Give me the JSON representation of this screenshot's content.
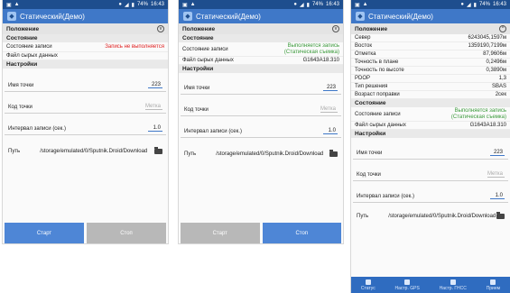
{
  "s1": {
    "status": {
      "time": "16:43",
      "battery": "74%"
    },
    "appbar": {
      "title": "Статический(Демо)"
    },
    "position_label": "Положение",
    "state_header": "Состояние",
    "record_state_label": "Состояние записи",
    "record_state_value": "Запись не выполняется",
    "raw_file_label": "Файл сырых данных",
    "settings_header": "Настройки",
    "point_name_label": "Имя точки",
    "point_name_value": "223",
    "point_code_label": "Код точки",
    "point_code_placeholder": "Метка",
    "interval_label": "Интервал записи (сек.)",
    "interval_value": "1.0",
    "path_label": "Путь",
    "path_value": "/storage/emulated/0/Sputnik.Droid/Download",
    "start_label": "Старт",
    "stop_label": "Стоп"
  },
  "s2": {
    "status": {
      "time": "16:43",
      "battery": "74%"
    },
    "appbar": {
      "title": "Статический(Демо)"
    },
    "position_label": "Положение",
    "state_header": "Состояние",
    "record_state_label": "Состояние записи",
    "record_state_value": "Выполняется запись (Статическая съемка)",
    "raw_file_label": "Файл сырых данных",
    "raw_file_value": "G1643A18.310",
    "settings_header": "Настройки",
    "point_name_label": "Имя точки",
    "point_name_value": "223",
    "point_code_label": "Код точки",
    "point_code_placeholder": "Метка",
    "interval_label": "Интервал записи (сек.)",
    "interval_value": "1.0",
    "path_label": "Путь",
    "path_value": "/storage/emulated/0/Sputnik.Droid/Download",
    "start_label": "Старт",
    "stop_label": "Стоп"
  },
  "s3": {
    "status": {
      "time": "16:43",
      "battery": "74%"
    },
    "appbar": {
      "title": "Статический(Демо)"
    },
    "position_label": "Положение",
    "rows": [
      {
        "label": "Север",
        "value": "6243045,1597м"
      },
      {
        "label": "Восток",
        "value": "1359190,7199м"
      },
      {
        "label": "Отметка",
        "value": "87,9606м"
      },
      {
        "label": "Точность в плане",
        "value": "0,2496м"
      },
      {
        "label": "Точность по высоте",
        "value": "0,3890м"
      },
      {
        "label": "PDOP",
        "value": "1,3"
      },
      {
        "label": "Тип решения",
        "value": "SBAS"
      },
      {
        "label": "Возраст поправки",
        "value": "2сек"
      }
    ],
    "state_header": "Состояние",
    "record_state_label": "Состояние записи",
    "record_state_value": "Выполняется запись (Статическая съемка)",
    "raw_file_label": "Файл сырых данных",
    "raw_file_value": "G1643A18.310",
    "settings_header": "Настройки",
    "point_name_label": "Имя точки",
    "point_name_value": "223",
    "point_code_label": "Код точки",
    "point_code_placeholder": "Метка",
    "interval_label": "Интервал записи (сек.)",
    "interval_value": "1.0",
    "path_label": "Путь",
    "path_value": "/storage/emulated/0/Sputnik.Droid/Download",
    "nav": [
      "Статус",
      "Настр. GPS",
      "Настр. ГНСС",
      "Прием"
    ]
  },
  "colors": {
    "appbar": "#3f78c8",
    "statusbar": "#1e4e8e",
    "button_active": "#4e86d6",
    "button_disabled": "#b8b8b8",
    "red": "#e02020",
    "green": "#3a9a3a"
  }
}
